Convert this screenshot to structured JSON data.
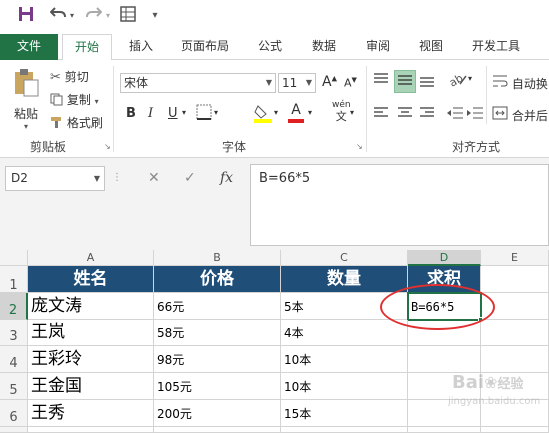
{
  "quick_access": {
    "save_icon": "save-icon",
    "undo_icon": "undo-icon",
    "redo_icon": "redo-icon",
    "table_icon": "table-icon",
    "customize_icon": "customize-icon"
  },
  "tabs": [
    "文件",
    "开始",
    "插入",
    "页面布局",
    "公式",
    "数据",
    "审阅",
    "视图",
    "开发工具"
  ],
  "ribbon": {
    "paste_label": "粘贴",
    "cut_label": "剪切",
    "copy_label": "复制",
    "format_painter_label": "格式刷",
    "clipboard_group": "剪贴板",
    "font_name": "宋体",
    "font_size": "11",
    "font_group": "字体",
    "bold": "B",
    "italic": "I",
    "underline": "U",
    "font_color_letter": "A",
    "phonetic": "wén",
    "phonetic_sub": "文",
    "grow_font": "A",
    "shrink_font": "A",
    "alignment_group": "对齐方式",
    "wrap_label": "自动换",
    "merge_label": "合并后"
  },
  "formula_bar": {
    "name_box": "D2",
    "cancel": "✕",
    "enter": "✓",
    "fx": "fx",
    "formula": "B=66*5"
  },
  "sheet": {
    "columns": [
      "A",
      "B",
      "C",
      "D",
      "E"
    ],
    "rows": [
      "1",
      "2",
      "3",
      "4",
      "5",
      "6"
    ],
    "header": [
      "姓名",
      "价格",
      "数量",
      "求积"
    ],
    "data": [
      {
        "name": "庞文涛",
        "price": "66元",
        "qty": "5本",
        "product": "B=66*5"
      },
      {
        "name": "王岚",
        "price": "58元",
        "qty": "4本",
        "product": ""
      },
      {
        "name": "王彩玲",
        "price": "98元",
        "qty": "10本",
        "product": ""
      },
      {
        "name": "王金国",
        "price": "105元",
        "qty": "10本",
        "product": ""
      },
      {
        "name": "王秀",
        "price": "200元",
        "qty": "15本",
        "product": ""
      }
    ]
  },
  "colors": {
    "accent": "#217346",
    "header_fill": "#1f4e79",
    "annotation": "#e03030"
  },
  "watermark": {
    "brand": "Bai",
    "brand2": "经验",
    "url": "jingyan.baidu.com"
  }
}
